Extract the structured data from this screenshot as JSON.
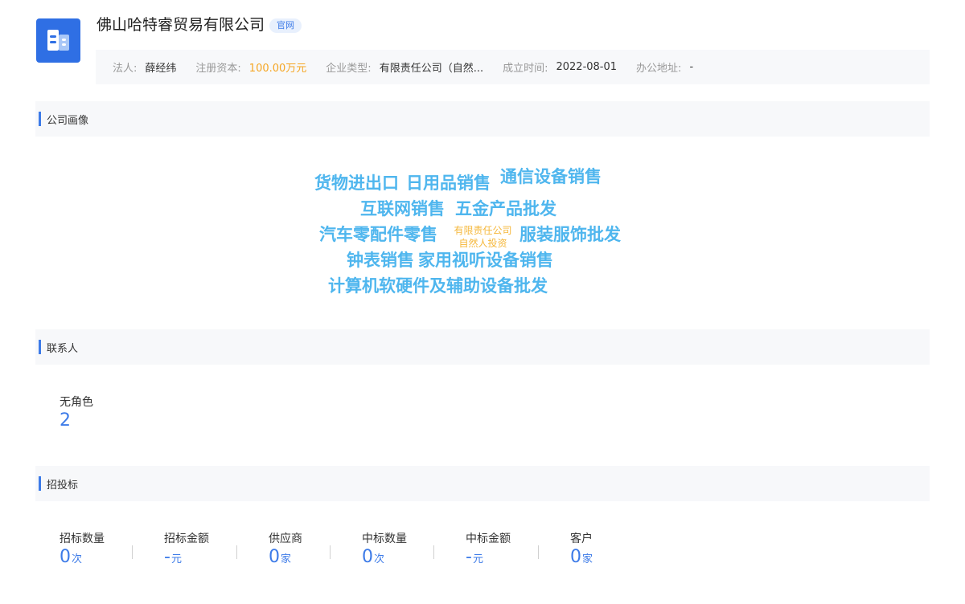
{
  "company": {
    "name": "佛山哈特睿贸易有限公司",
    "badge": "官网"
  },
  "info": {
    "legal_label": "法人:",
    "legal_value": "薛经纬",
    "capital_label": "注册资本:",
    "capital_value": "100.00万元",
    "type_label": "企业类型:",
    "type_value": "有限责任公司（自然...",
    "founded_label": "成立时间:",
    "founded_value": "2022-08-01",
    "address_label": "办公地址:",
    "address_value": "-"
  },
  "sections": {
    "portrait": "公司画像",
    "contacts": "联系人",
    "bidding": "招投标"
  },
  "word_cloud": {
    "words": [
      "货物进出口",
      "日用品销售",
      "通信设备销售",
      "互联网销售",
      "五金产品批发",
      "汽车零配件零售",
      "有限责任公司",
      "自然人投资",
      "服装服饰批发",
      "钟表销售",
      "家用视听设备销售",
      "计算机软硬件及辅助设备批发"
    ],
    "primary_color": "#4fb6ee",
    "secondary_color": "#f5b73a"
  },
  "contacts": {
    "label": "无角色",
    "value": "2"
  },
  "bidding": {
    "stats": [
      {
        "label": "招标数量",
        "value": "0",
        "unit": "次"
      },
      {
        "label": "招标金额",
        "value": "-",
        "unit": "元"
      },
      {
        "label": "供应商",
        "value": "0",
        "unit": "家"
      },
      {
        "label": "中标数量",
        "value": "0",
        "unit": "次"
      },
      {
        "label": "中标金额",
        "value": "-",
        "unit": "元"
      },
      {
        "label": "客户",
        "value": "0",
        "unit": "家"
      }
    ]
  },
  "colors": {
    "accent": "#3d7be8",
    "money": "#f5a623",
    "logo_bg": "#2f6fe4"
  }
}
